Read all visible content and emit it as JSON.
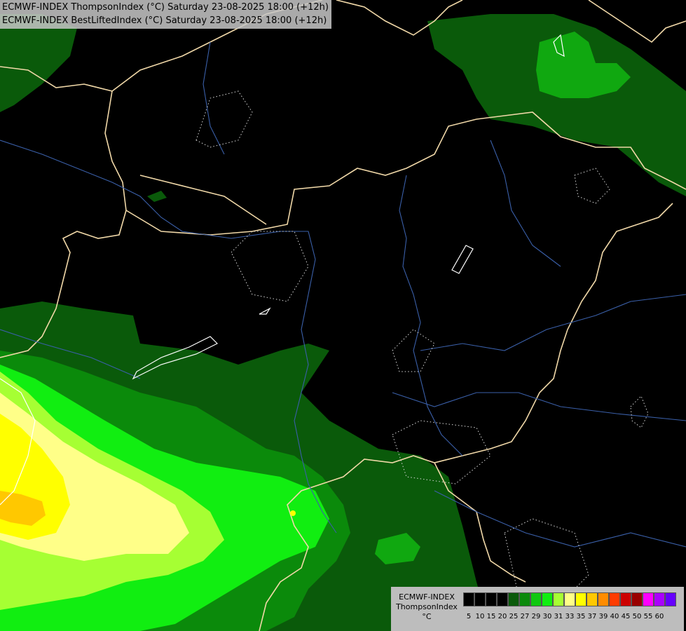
{
  "header": {
    "title_line1": "ECMWF-INDEX ThompsonIndex (°C) Saturday 23-08-2025 18:00 (+12h)",
    "title_line2": "ECMWF-INDEX BestLiftedIndex (°C) Saturday 23-08-2025 18:00 (+12h)"
  },
  "legend": {
    "label_line1": "ECMWF-INDEX",
    "label_line2": "ThompsonIndex",
    "label_line3": "°C",
    "ticks": [
      "5",
      "10",
      "15",
      "20",
      "25",
      "27",
      "29",
      "30",
      "31",
      "33",
      "35",
      "37",
      "39",
      "40",
      "45",
      "50",
      "55",
      "60"
    ],
    "colors": [
      "#000000",
      "#000000",
      "#000000",
      "#000000",
      "#0a5a0a",
      "#0b8a0b",
      "#10c810",
      "#11ee11",
      "#a6ff33",
      "#ffff88",
      "#ffff00",
      "#ffc800",
      "#ff8c00",
      "#ff3c00",
      "#cc0000",
      "#990000",
      "#ff00ff",
      "#aa00ff",
      "#6600ff",
      "#0000ff"
    ]
  },
  "colors": {
    "background": "#000000",
    "borders": "#f0d8a8",
    "rivers": "#3a5fa8",
    "contour": "#d8d8d8"
  }
}
